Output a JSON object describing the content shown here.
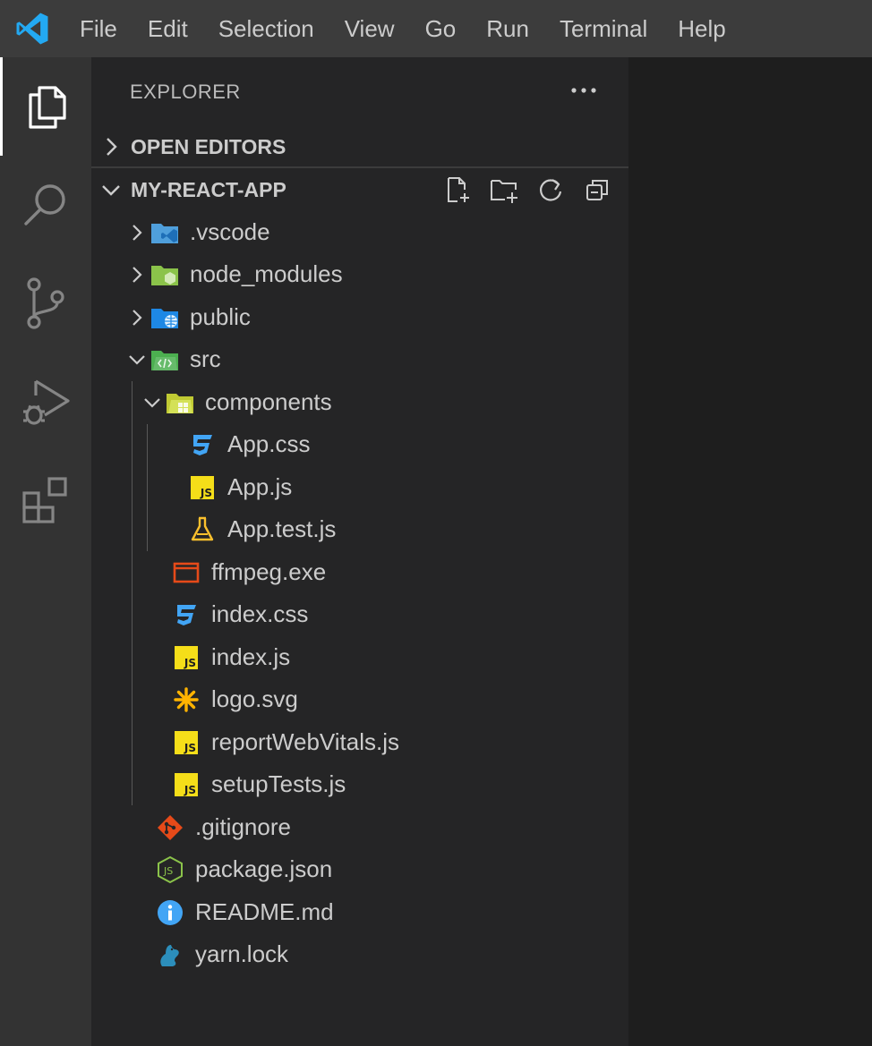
{
  "menu": {
    "logo_icon": "vscode-logo-icon",
    "items": [
      "File",
      "Edit",
      "Selection",
      "View",
      "Go",
      "Run",
      "Terminal",
      "Help"
    ]
  },
  "activity_bar": {
    "items": [
      "explorer-icon",
      "search-icon",
      "source-control-icon",
      "run-debug-icon",
      "extensions-icon"
    ],
    "active": "explorer-icon"
  },
  "sidebar": {
    "title": "EXPLORER",
    "more_icon": "ellipsis-icon",
    "open_editors": {
      "label": "OPEN EDITORS",
      "expanded": false
    },
    "workspace": {
      "label": "MY-REACT-APP",
      "expanded": true,
      "actions": [
        "new-file-icon",
        "new-folder-icon",
        "refresh-icon",
        "collapse-all-icon"
      ]
    },
    "tree": [
      {
        "label": ".vscode",
        "type": "folder",
        "expanded": false,
        "depth": 1,
        "icon": "vscode-folder-icon"
      },
      {
        "label": "node_modules",
        "type": "folder",
        "expanded": false,
        "depth": 1,
        "icon": "node-folder-icon"
      },
      {
        "label": "public",
        "type": "folder",
        "expanded": false,
        "depth": 1,
        "icon": "public-folder-icon"
      },
      {
        "label": "src",
        "type": "folder",
        "expanded": true,
        "depth": 1,
        "icon": "src-folder-icon"
      },
      {
        "label": "components",
        "type": "folder",
        "expanded": true,
        "depth": 2,
        "icon": "components-folder-icon"
      },
      {
        "label": "App.css",
        "type": "file",
        "depth": 3,
        "icon": "css-icon"
      },
      {
        "label": "App.js",
        "type": "file",
        "depth": 3,
        "icon": "js-icon"
      },
      {
        "label": "App.test.js",
        "type": "file",
        "depth": 3,
        "icon": "test-flask-icon"
      },
      {
        "label": "ffmpeg.exe",
        "type": "file",
        "depth": 2,
        "icon": "exe-icon"
      },
      {
        "label": "index.css",
        "type": "file",
        "depth": 2,
        "icon": "css-icon"
      },
      {
        "label": "index.js",
        "type": "file",
        "depth": 2,
        "icon": "js-icon"
      },
      {
        "label": "logo.svg",
        "type": "file",
        "depth": 2,
        "icon": "svg-icon"
      },
      {
        "label": "reportWebVitals.js",
        "type": "file",
        "depth": 2,
        "icon": "js-icon"
      },
      {
        "label": "setupTests.js",
        "type": "file",
        "depth": 2,
        "icon": "js-icon"
      },
      {
        "label": ".gitignore",
        "type": "file",
        "depth": 1,
        "icon": "git-icon"
      },
      {
        "label": "package.json",
        "type": "file",
        "depth": 1,
        "icon": "node-json-icon"
      },
      {
        "label": "README.md",
        "type": "file",
        "depth": 1,
        "icon": "info-icon"
      },
      {
        "label": "yarn.lock",
        "type": "file",
        "depth": 1,
        "icon": "yarn-icon"
      }
    ]
  },
  "colors": {
    "titlebar": "#3c3c3c",
    "activitybar": "#333333",
    "sidebar": "#252526",
    "editor": "#1e1e1e",
    "accent_blue": "#23a9f2"
  }
}
